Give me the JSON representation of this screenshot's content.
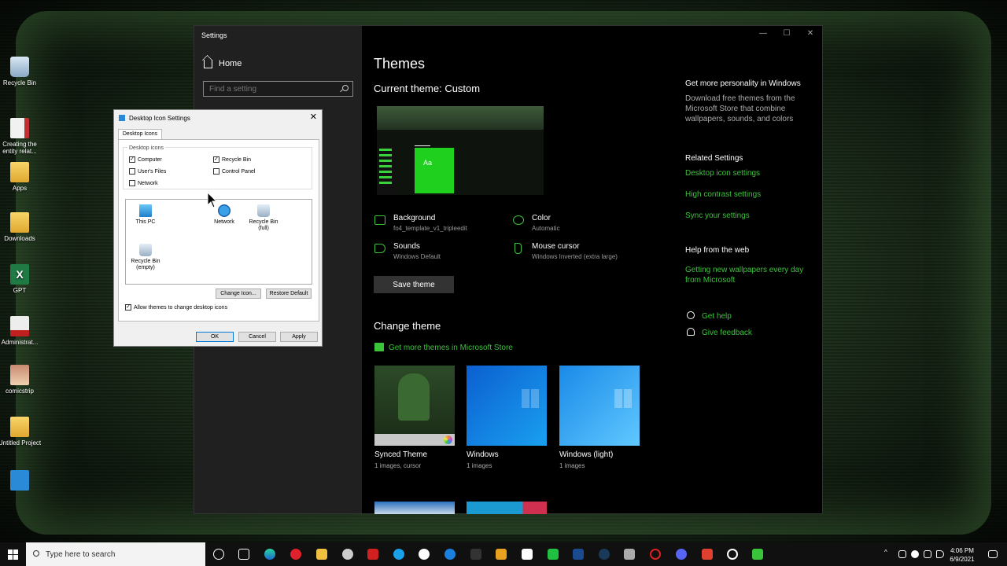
{
  "desktop": {
    "icons": [
      {
        "label": "Recycle Bin",
        "glyph": "recycle-bin-icon"
      },
      {
        "label": "Creating the entity relat...",
        "glyph": "document-icon"
      },
      {
        "label": "Apps",
        "glyph": "folder-icon"
      },
      {
        "label": "Downloads",
        "glyph": "folder-icon"
      },
      {
        "label": "GPT",
        "glyph": "excel-icon"
      },
      {
        "label": "Administrat...",
        "glyph": "pdf-icon"
      },
      {
        "label": "comicstrip",
        "glyph": "image-icon"
      },
      {
        "label": "Untitled Project",
        "glyph": "folder-icon"
      },
      {
        "label": "",
        "glyph": "app-icon"
      }
    ]
  },
  "settings": {
    "window_title": "Settings",
    "window_controls": {
      "minimize": "—",
      "maximize": "☐",
      "close": "✕"
    },
    "home_label": "Home",
    "search_placeholder": "Find a setting",
    "page_title": "Themes",
    "current_theme": "Current theme: Custom",
    "preview_tile_text": "Aa",
    "properties": {
      "background": {
        "label": "Background",
        "value": "fo4_template_v1_tripleedit"
      },
      "color": {
        "label": "Color",
        "value": "Automatic"
      },
      "sounds": {
        "label": "Sounds",
        "value": "Windows Default"
      },
      "cursor": {
        "label": "Mouse cursor",
        "value": "Windows Inverted (extra large)"
      }
    },
    "save_theme": "Save theme",
    "change_theme": "Change theme",
    "store_link": "Get more themes in Microsoft Store",
    "themes": [
      {
        "name": "Synced Theme",
        "sub": "1 images, cursor"
      },
      {
        "name": "Windows",
        "sub": "1 images"
      },
      {
        "name": "Windows (light)",
        "sub": "1 images"
      }
    ],
    "right": {
      "personality_title": "Get more personality in Windows",
      "personality_text": "Download free themes from the Microsoft Store that combine wallpapers, sounds, and colors",
      "related_title": "Related Settings",
      "related_links": [
        "Desktop icon settings",
        "High contrast settings",
        "Sync your settings"
      ],
      "web_title": "Help from the web",
      "web_link": "Getting new wallpapers every day from Microsoft",
      "get_help": "Get help",
      "give_feedback": "Give feedback"
    }
  },
  "dialog": {
    "title": "Desktop Icon Settings",
    "close": "✕",
    "tab": "Desktop Icons",
    "group_label": "Desktop icons",
    "checkboxes": [
      {
        "label": "Computer",
        "checked": true
      },
      {
        "label": "Recycle Bin",
        "checked": true
      },
      {
        "label": "User's Files",
        "checked": false
      },
      {
        "label": "Control Panel",
        "checked": false
      },
      {
        "label": "Network",
        "checked": false
      }
    ],
    "icons": [
      {
        "label": "This PC"
      },
      {
        "label": "Network"
      },
      {
        "label": "Recycle Bin (full)"
      },
      {
        "label": "Recycle Bin (empty)"
      }
    ],
    "change_icon": "Change Icon...",
    "restore_default": "Restore Default",
    "allow_themes": "Allow themes to change desktop icons",
    "allow_themes_checked": true,
    "ok": "OK",
    "cancel": "Cancel",
    "apply": "Apply",
    "check_mark": "✓"
  },
  "taskbar": {
    "search_placeholder": "Type here to search",
    "time": "4:06 PM",
    "date": "6/9/2021",
    "tray_arrow": "^"
  },
  "colors": {
    "accent": "#3ac43a",
    "settings_bg": "#000000",
    "sidebar_bg": "#202020",
    "dialog_bg": "#f0f0f0",
    "taskbar_bg": "#101010"
  }
}
